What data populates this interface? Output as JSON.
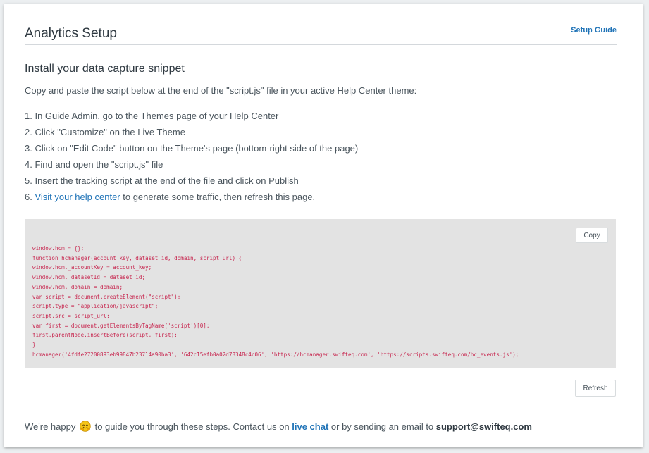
{
  "header": {
    "title": "Analytics Setup",
    "guide_link": "Setup Guide"
  },
  "section": {
    "title": "Install your data capture snippet",
    "intro": "Copy and paste the script below at the end of the \"script.js\" file in your active Help Center theme:"
  },
  "steps": [
    "1. In Guide Admin, go to the Themes page of your Help Center",
    "2. Click \"Customize\" on the Live Theme",
    "3. Click on \"Edit Code\" button on the Theme's page (bottom-right side of the page)",
    "4. Find and open the \"script.js\" file",
    "5. Insert the tracking script at the end of the file and click on Publish"
  ],
  "step6": {
    "prefix": "6. ",
    "link": "Visit your help center",
    "suffix": " to generate some traffic, then refresh this page."
  },
  "code": {
    "copy_label": "Copy",
    "lines": [
      "window.hcm = {};",
      "function hcmanager(account_key, dataset_id, domain, script_url) {",
      "window.hcm._accountKey = account_key;",
      "window.hcm._datasetId = dataset_id;",
      "window.hcm._domain = domain;",
      "var script = document.createElement(\"script\");",
      "script.type = \"application/javascript\";",
      "script.src = script_url;",
      "var first = document.getElementsByTagName('script')[0];",
      "first.parentNode.insertBefore(script, first);",
      "}",
      "hcmanager('4fdfe27200893eb99847b23714a90ba3', '642c15efb0a02d78348c4c06', 'https://hcmanager.swifteq.com', 'https://scripts.swifteq.com/hc_events.js');"
    ]
  },
  "refresh_label": "Refresh",
  "footer": {
    "part1": "We're happy",
    "emoji_icon": "hugging-face-emoji",
    "part2": " to guide you through these steps. Contact us on ",
    "live_chat": "live chat",
    "part3": " or by sending an email to ",
    "email": "support@swifteq.com"
  }
}
